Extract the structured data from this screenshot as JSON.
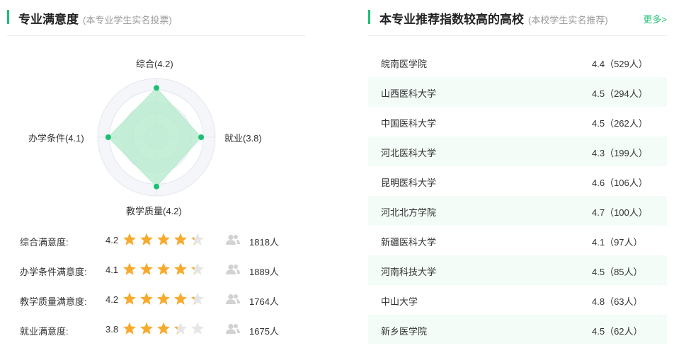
{
  "satisfaction": {
    "title": "专业满意度",
    "subtitle": "(本专业学生实名投票)",
    "radar": {
      "labels": {
        "top": "综合(4.2)",
        "right": "就业(3.8)",
        "bottom": "教学质量(4.2)",
        "left": "办学条件(4.1)"
      },
      "values": {
        "top": 4.2,
        "right": 3.8,
        "bottom": 4.2,
        "left": 4.1
      },
      "max": 5,
      "fill_color": "#b6ebcd",
      "point_color": "#1dbf73"
    },
    "ratings": [
      {
        "label": "综合满意度:",
        "score": "4.2",
        "stars": 4.5,
        "count": "1818人"
      },
      {
        "label": "办学条件满意度:",
        "score": "4.1",
        "stars": 4.5,
        "count": "1889人"
      },
      {
        "label": "教学质量满意度:",
        "score": "4.2",
        "stars": 4.5,
        "count": "1764人"
      },
      {
        "label": "就业满意度:",
        "score": "3.8",
        "stars": 3.5,
        "count": "1675人"
      }
    ],
    "star_color": "#f7ab2e",
    "star_empty_color": "#e6e6e6"
  },
  "recommend": {
    "title": "本专业推荐指数较高的高校",
    "subtitle": "(本校学生实名推荐)",
    "more": "更多>",
    "schools": [
      {
        "name": "皖南医学院",
        "score": "4.4（529人）"
      },
      {
        "name": "山西医科大学",
        "score": "4.5（294人）"
      },
      {
        "name": "中国医科大学",
        "score": "4.5（262人）"
      },
      {
        "name": "河北医科大学",
        "score": "4.3（199人）"
      },
      {
        "name": "昆明医科大学",
        "score": "4.6（106人）"
      },
      {
        "name": "河北北方学院",
        "score": "4.7（100人）"
      },
      {
        "name": "新疆医科大学",
        "score": "4.1（97人）"
      },
      {
        "name": "河南科技大学",
        "score": "4.5（85人）"
      },
      {
        "name": "中山大学",
        "score": "4.8（63人）"
      },
      {
        "name": "新乡医学院",
        "score": "4.5（62人）"
      }
    ]
  },
  "accent_color": "#1dbf73"
}
